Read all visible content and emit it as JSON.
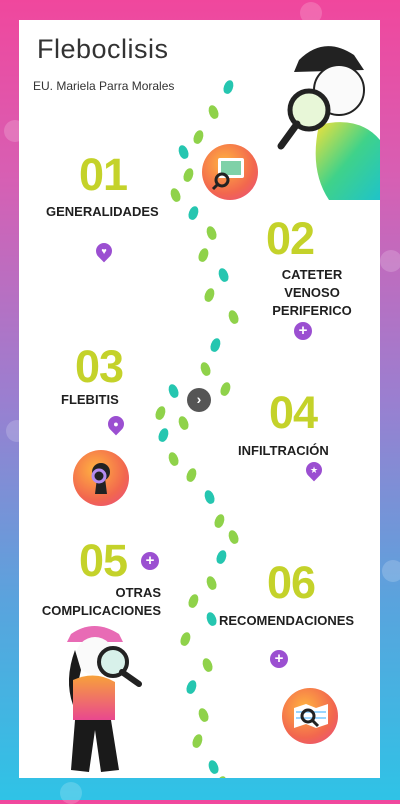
{
  "header": {
    "title": "Fleboclisis",
    "author": "EU. Mariela Parra Morales"
  },
  "sections": [
    {
      "num": "01",
      "label": "GENERALIDADES"
    },
    {
      "num": "02",
      "label": "CATETER VENOSO PERIFERICO"
    },
    {
      "num": "03",
      "label": "FLEBITIS"
    },
    {
      "num": "04",
      "label": "INFILTRACIÓN"
    },
    {
      "num": "05",
      "label": "OTRAS COMPLICACIONES"
    },
    {
      "num": "06",
      "label": "RECOMENDACIONES"
    }
  ],
  "icons": {
    "heart": "heart-pin-icon",
    "plus": "plus-icon",
    "eye": "eye-pin-icon",
    "star": "star-pin-icon",
    "next": "chevron-right-icon"
  },
  "colors": {
    "accent": "#c4d22a",
    "pin": "#9b4fd1",
    "footprint_green": "#8fd24a",
    "footprint_teal": "#25c6b0"
  }
}
